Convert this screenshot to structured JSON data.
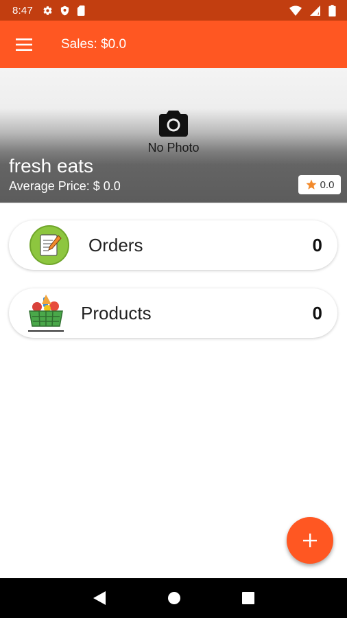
{
  "status_bar": {
    "time": "8:47"
  },
  "app_bar": {
    "title": "Sales: $0.0"
  },
  "header": {
    "no_photo": "No Photo",
    "store_name": "fresh eats",
    "average_price": "Average Price: $ 0.0",
    "rating": "0.0"
  },
  "cards": [
    {
      "label": "Orders",
      "count": "0",
      "icon": "orders-notepad-icon"
    },
    {
      "label": "Products",
      "count": "0",
      "icon": "grocery-basket-icon"
    }
  ],
  "colors": {
    "primary": "#ff5722",
    "status_bar": "#c23e10",
    "star": "#f28a2c"
  }
}
